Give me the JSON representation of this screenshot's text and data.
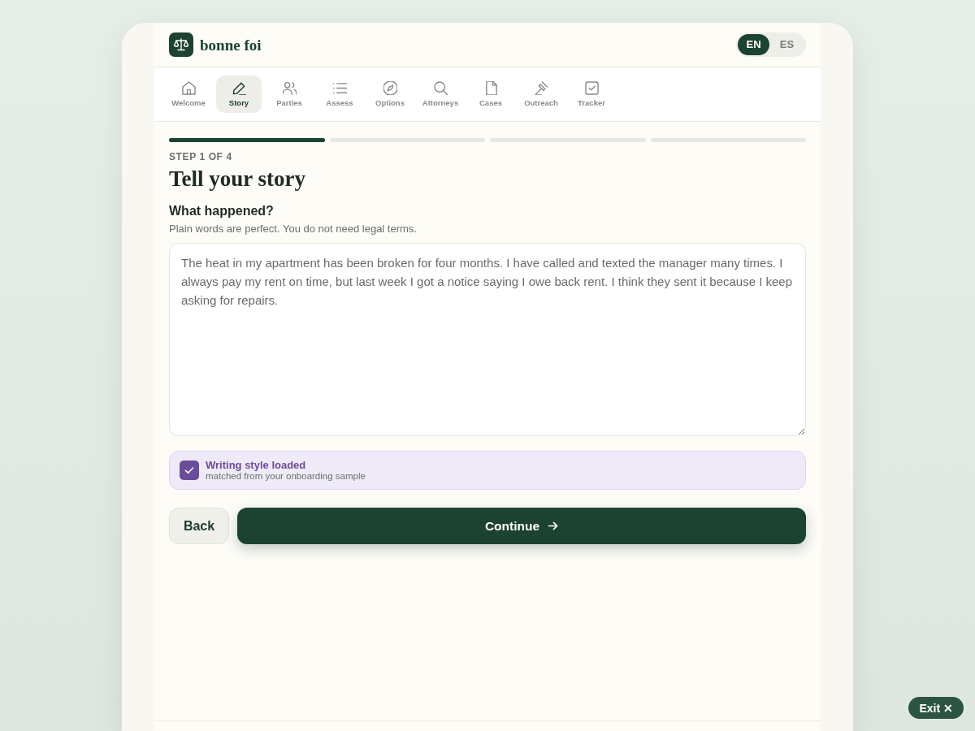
{
  "app": {
    "name": "bonne foi"
  },
  "languages": [
    {
      "label": "EN",
      "selected": true
    },
    {
      "label": "ES",
      "selected": false
    }
  ],
  "nav": [
    {
      "label": "Welcome",
      "selected": false
    },
    {
      "label": "Story",
      "selected": true
    },
    {
      "label": "Parties",
      "selected": false
    },
    {
      "label": "Assess",
      "selected": false
    },
    {
      "label": "Options",
      "selected": false
    },
    {
      "label": "Attorneys",
      "selected": false
    },
    {
      "label": "Cases",
      "selected": false
    },
    {
      "label": "Outreach",
      "selected": false
    },
    {
      "label": "Tracker",
      "selected": false
    }
  ],
  "progress": [
    {
      "filled": true
    },
    {
      "filled": false
    },
    {
      "filled": false
    },
    {
      "filled": false
    }
  ],
  "step_label": "STEP 1 OF 4",
  "title": "Tell your story",
  "question": {
    "label": "What happened?",
    "hint": "Plain words are perfect. You do not need legal terms.",
    "value": "The heat in my apartment has been broken for four months. I have called and texted the manager many times. I always pay my rent on time, but last week I got a notice saying I owe back rent. I think they sent it because I keep asking for repairs."
  },
  "notice": {
    "title": "Writing style loaded",
    "detail": "matched from your onboarding sample"
  },
  "buttons": [
    {
      "label": "Back",
      "kind": "secondary"
    },
    {
      "label": "Continue",
      "kind": "primary"
    }
  ],
  "exit_button": {
    "label": "Exit ✕"
  }
}
